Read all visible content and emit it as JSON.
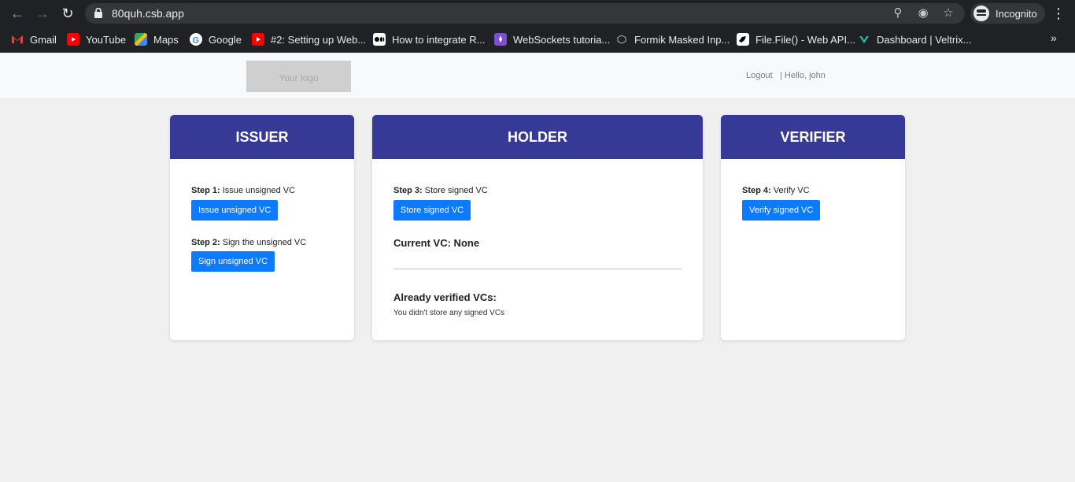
{
  "browser": {
    "url": "80quh.csb.app",
    "profile_label": "Incognito",
    "bookmarks": [
      {
        "label": "Gmail",
        "color": "#ea4335"
      },
      {
        "label": "YouTube",
        "color": "#ff0000"
      },
      {
        "label": "Maps",
        "color": "#34a853"
      },
      {
        "label": "Google",
        "color": "#4285f4"
      },
      {
        "label": "#2: Setting up Web...",
        "color": "#ff0000"
      },
      {
        "label": "How to integrate R...",
        "color": "#ffffff"
      },
      {
        "label": "WebSockets tutoria...",
        "color": "#7b4fd6"
      },
      {
        "label": "Formik Masked Inp...",
        "color": "#9aa0a6"
      },
      {
        "label": "File.File() - Web API...",
        "color": "#ffffff"
      },
      {
        "label": "Dashboard | Veltrix...",
        "color": "#23b9a2"
      }
    ],
    "more_label": "»"
  },
  "header": {
    "logo_text": "Your logo",
    "logout_label": "Logout",
    "greeting": "| Hello, john"
  },
  "issuer": {
    "title": "ISSUER",
    "step1_prefix": "Step 1:",
    "step1_text": " Issue unsigned VC",
    "step1_button": "Issue unsigned VC",
    "step2_prefix": "Step 2:",
    "step2_text": " Sign the unsigned VC",
    "step2_button": "Sign unsigned VC"
  },
  "holder": {
    "title": "HOLDER",
    "step3_prefix": "Step 3:",
    "step3_text": " Store signed VC",
    "step3_button": "Store signed VC",
    "current_vc": "Current VC: None",
    "verified_title": "Already verified VCs:",
    "verified_empty": "You didn't store any signed VCs"
  },
  "verifier": {
    "title": "VERIFIER",
    "step4_prefix": "Step 4:",
    "step4_text": " Verify VC",
    "step4_button": "Verify signed VC"
  },
  "colors": {
    "card_header": "#363a96",
    "button": "#0d7bff"
  }
}
